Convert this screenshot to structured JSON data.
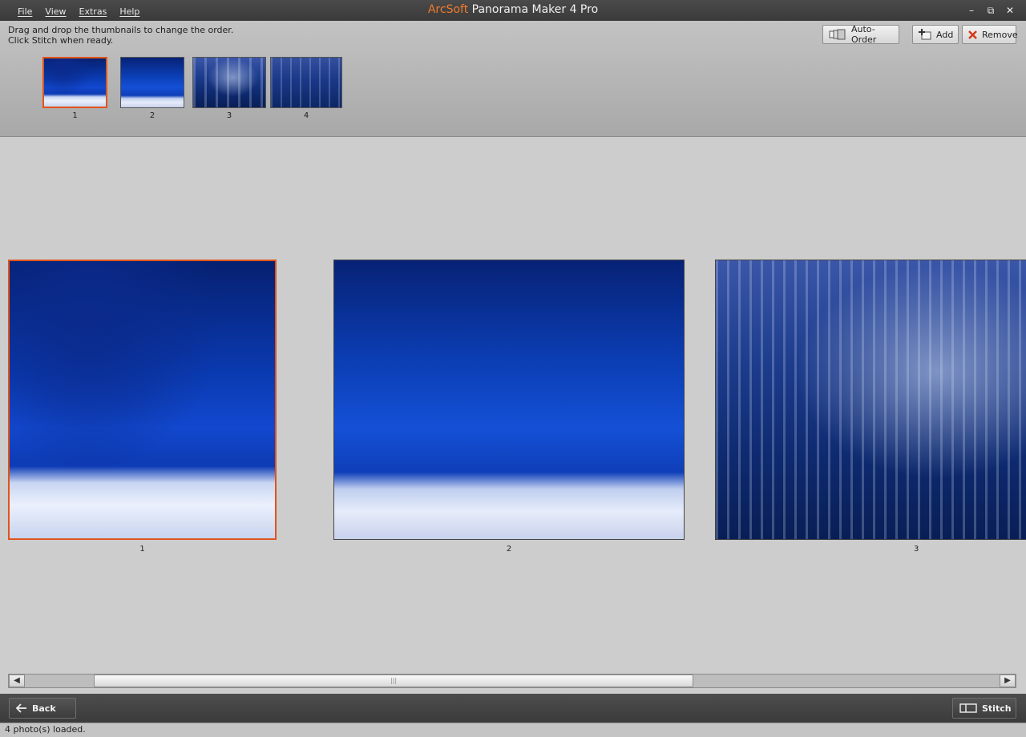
{
  "window": {
    "title_brand": "ArcSoft",
    "title_product": "Panorama Maker 4 Pro",
    "minimize": "–",
    "restore": "⧉",
    "close": "✕"
  },
  "menu": {
    "items": [
      {
        "label": "File"
      },
      {
        "label": "View"
      },
      {
        "label": "Extras"
      },
      {
        "label": "Help"
      }
    ]
  },
  "toolbar": {
    "instruction_line1": "Drag and drop the thumbnails to change the order.",
    "instruction_line2": "Click Stitch when ready.",
    "auto_order_label": "Auto-Order",
    "add_label": "Add",
    "remove_label": "Remove",
    "remove_icon_color": "#d43a1a"
  },
  "thumbnails": [
    {
      "number": "1",
      "selected": true
    },
    {
      "number": "2",
      "selected": false
    },
    {
      "number": "3",
      "selected": false
    },
    {
      "number": "4",
      "selected": false
    }
  ],
  "previews": [
    {
      "number": "1",
      "selected": true
    },
    {
      "number": "2",
      "selected": false
    },
    {
      "number": "3",
      "selected": false
    }
  ],
  "scrollbar": {
    "left_arrow": "◀",
    "right_arrow": "▶",
    "grip": "|||"
  },
  "bottom": {
    "back_label": "Back",
    "stitch_label": "Stitch"
  },
  "status": {
    "text": "4 photo(s) loaded."
  },
  "colors": {
    "selection": "#e0541b",
    "brand": "#f07b2c"
  }
}
